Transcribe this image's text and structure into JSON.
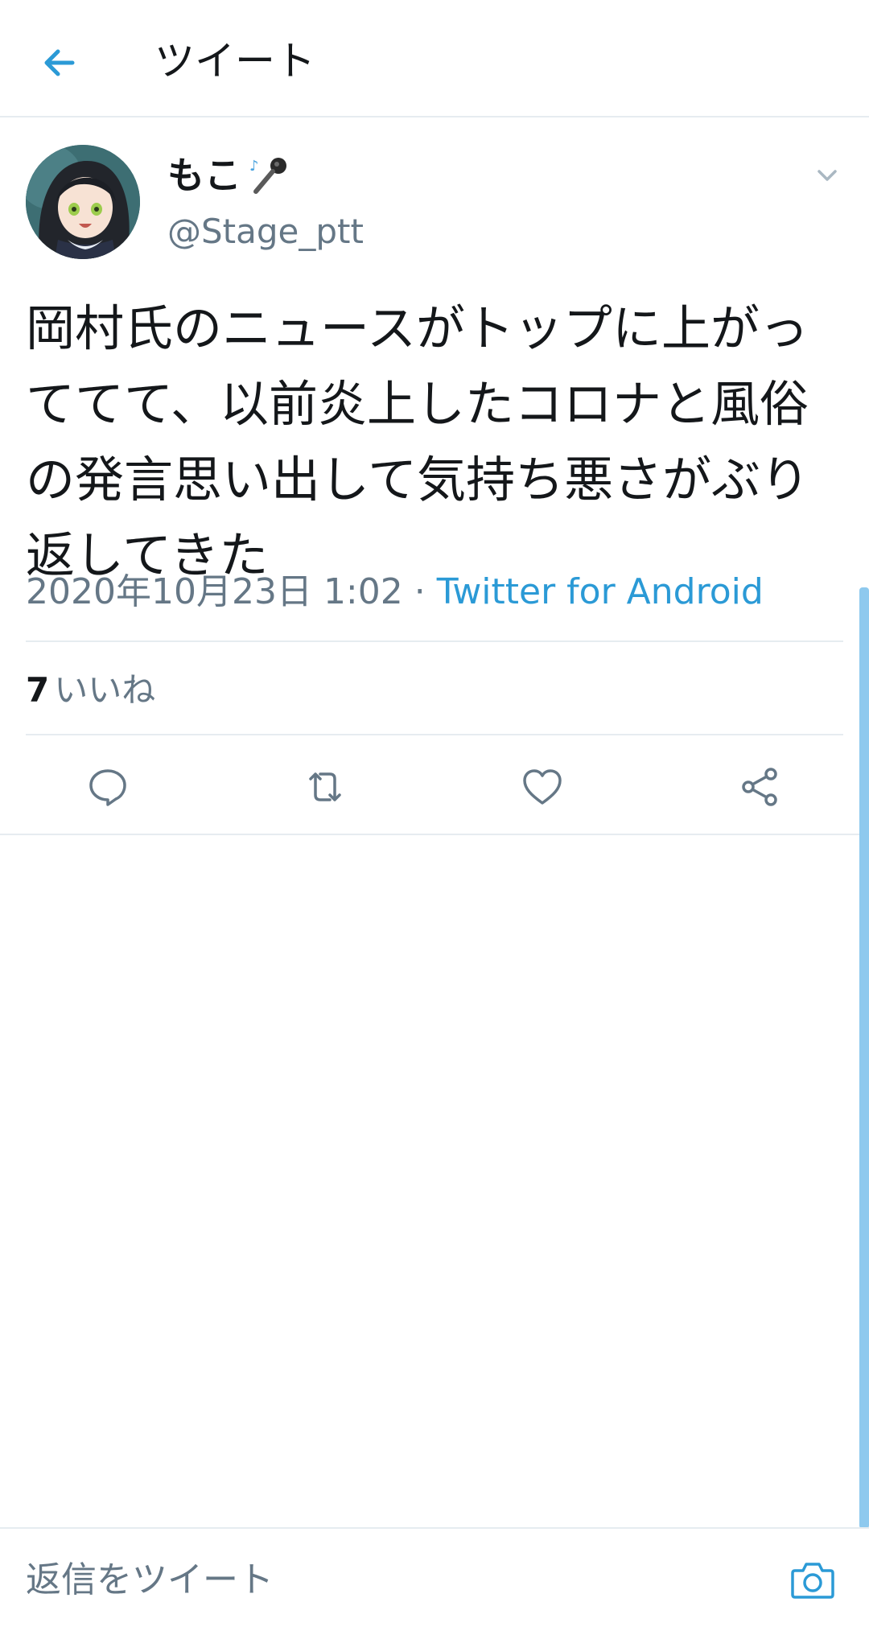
{
  "topbar": {
    "back_icon": "arrow-left-icon",
    "title": "ツイート"
  },
  "author": {
    "display_name": "もこ",
    "name_emoji": "🎤",
    "name_note": "♪",
    "handle": "@Stage_ptt",
    "avatar_icon": "user-avatar",
    "menu_icon": "chevron-down-icon"
  },
  "tweet": {
    "text": "岡村氏のニュースがトップに上がっててて、以前炎上したコロナと風俗の発言思い出して気持ち悪さがぶり返してきた",
    "timestamp": "2020年10月23日 1:02",
    "separator": " · ",
    "source": "Twitter for Android"
  },
  "stats": {
    "likes_count": "7",
    "likes_label": "いいね"
  },
  "actions": {
    "reply_icon": "reply-icon",
    "retweet_icon": "retweet-icon",
    "like_icon": "heart-icon",
    "share_icon": "share-icon"
  },
  "reply_bar": {
    "placeholder": "返信をツイート",
    "camera_icon": "camera-icon"
  },
  "colors": {
    "accent": "#2b9ad6",
    "text": "#14171a",
    "secondary": "#657786",
    "divider": "#e6ecf0",
    "scrollbar": "#8ec9ee"
  }
}
